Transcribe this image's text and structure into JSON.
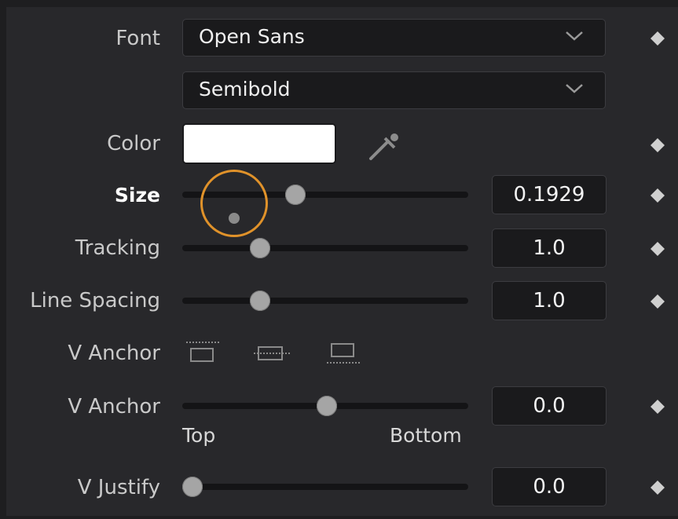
{
  "font": {
    "label": "Font",
    "family_value": "Open Sans",
    "style_value": "Semibold"
  },
  "color": {
    "label": "Color",
    "swatch": "#ffffff",
    "picker_icon": "eyedropper-icon"
  },
  "size": {
    "label": "Size",
    "value": "0.1929"
  },
  "tracking": {
    "label": "Tracking",
    "value": "1.0"
  },
  "line_spacing": {
    "label": "Line Spacing",
    "value": "1.0"
  },
  "v_anchor_buttons": {
    "label": "V Anchor",
    "options": [
      "anchor-top-icon",
      "anchor-middle-icon",
      "anchor-bottom-icon"
    ]
  },
  "v_anchor_slider": {
    "label": "V Anchor",
    "value": "0.0",
    "min_label": "Top",
    "max_label": "Bottom"
  },
  "v_justify": {
    "label": "V Justify",
    "value": "0.0"
  },
  "accent_color": "#e0922a",
  "keyframe_icon": "keyframe-diamond-icon"
}
